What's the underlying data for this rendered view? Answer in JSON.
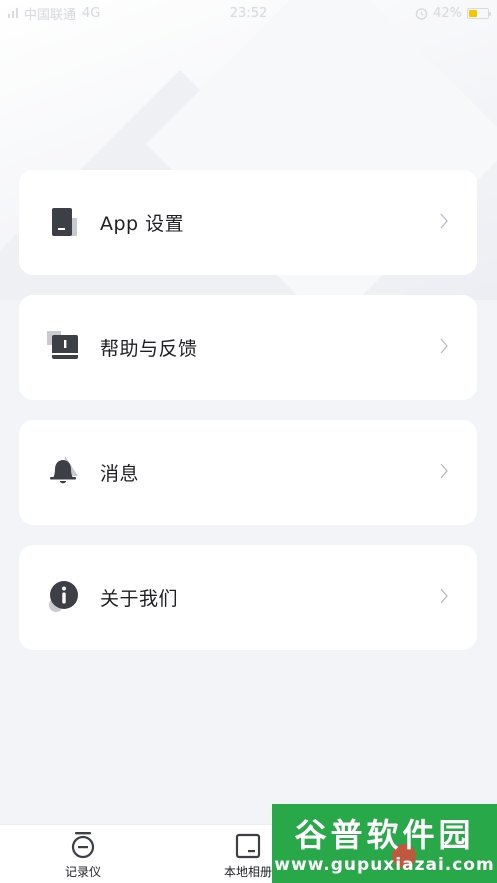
{
  "status_bar": {
    "carrier": "中国联通",
    "network": "4G",
    "time": "23:52",
    "battery_percent": "42%",
    "battery_level": 0.42,
    "icons": [
      "signal-icon",
      "alarm-icon",
      "battery-icon"
    ]
  },
  "menu": {
    "items": [
      {
        "label": "App 设置",
        "icon": "document-icon"
      },
      {
        "label": "帮助与反馈",
        "icon": "help-book-icon"
      },
      {
        "label": "消息",
        "icon": "bell-icon"
      },
      {
        "label": "关于我们",
        "icon": "info-icon"
      }
    ],
    "chevron_icon": "chevron-right-icon"
  },
  "bottom_nav": {
    "items": [
      {
        "label": "记录仪",
        "icon": "recorder-icon"
      },
      {
        "label": "本地相册",
        "icon": "album-icon"
      }
    ]
  },
  "watermark": {
    "title": "谷普软件园",
    "url": "www.gupuxiazai.com"
  },
  "colors": {
    "background": "#f3f4f8",
    "card": "#ffffff",
    "icon_dark": "#3d3f47",
    "icon_shadow": "#c8cad0",
    "chevron": "#b8bbc2",
    "battery": "#f7c600",
    "watermark_green": "#29a84a"
  }
}
